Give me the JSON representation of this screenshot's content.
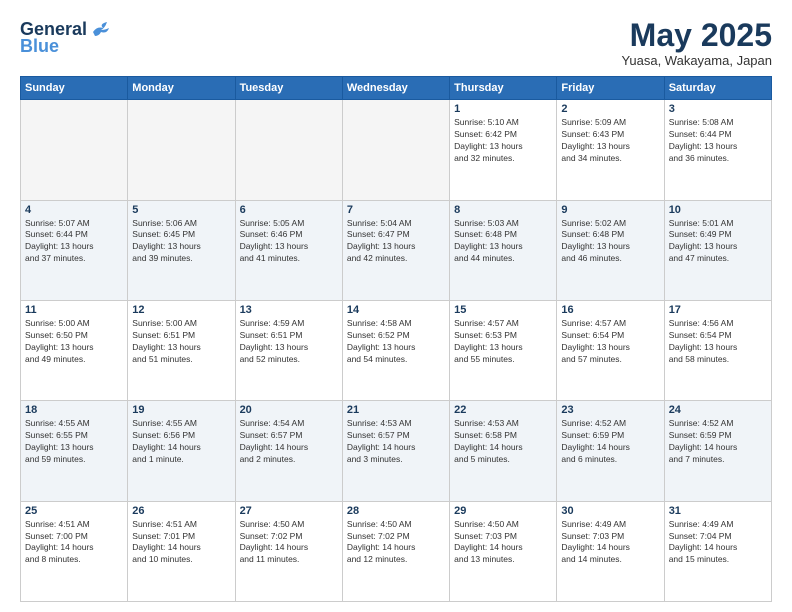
{
  "header": {
    "logo_line1": "General",
    "logo_line2": "Blue",
    "title": "May 2025",
    "location": "Yuasa, Wakayama, Japan"
  },
  "weekdays": [
    "Sunday",
    "Monday",
    "Tuesday",
    "Wednesday",
    "Thursday",
    "Friday",
    "Saturday"
  ],
  "weeks": [
    [
      {
        "day": "",
        "info": ""
      },
      {
        "day": "",
        "info": ""
      },
      {
        "day": "",
        "info": ""
      },
      {
        "day": "",
        "info": ""
      },
      {
        "day": "1",
        "info": "Sunrise: 5:10 AM\nSunset: 6:42 PM\nDaylight: 13 hours\nand 32 minutes."
      },
      {
        "day": "2",
        "info": "Sunrise: 5:09 AM\nSunset: 6:43 PM\nDaylight: 13 hours\nand 34 minutes."
      },
      {
        "day": "3",
        "info": "Sunrise: 5:08 AM\nSunset: 6:44 PM\nDaylight: 13 hours\nand 36 minutes."
      }
    ],
    [
      {
        "day": "4",
        "info": "Sunrise: 5:07 AM\nSunset: 6:44 PM\nDaylight: 13 hours\nand 37 minutes."
      },
      {
        "day": "5",
        "info": "Sunrise: 5:06 AM\nSunset: 6:45 PM\nDaylight: 13 hours\nand 39 minutes."
      },
      {
        "day": "6",
        "info": "Sunrise: 5:05 AM\nSunset: 6:46 PM\nDaylight: 13 hours\nand 41 minutes."
      },
      {
        "day": "7",
        "info": "Sunrise: 5:04 AM\nSunset: 6:47 PM\nDaylight: 13 hours\nand 42 minutes."
      },
      {
        "day": "8",
        "info": "Sunrise: 5:03 AM\nSunset: 6:48 PM\nDaylight: 13 hours\nand 44 minutes."
      },
      {
        "day": "9",
        "info": "Sunrise: 5:02 AM\nSunset: 6:48 PM\nDaylight: 13 hours\nand 46 minutes."
      },
      {
        "day": "10",
        "info": "Sunrise: 5:01 AM\nSunset: 6:49 PM\nDaylight: 13 hours\nand 47 minutes."
      }
    ],
    [
      {
        "day": "11",
        "info": "Sunrise: 5:00 AM\nSunset: 6:50 PM\nDaylight: 13 hours\nand 49 minutes."
      },
      {
        "day": "12",
        "info": "Sunrise: 5:00 AM\nSunset: 6:51 PM\nDaylight: 13 hours\nand 51 minutes."
      },
      {
        "day": "13",
        "info": "Sunrise: 4:59 AM\nSunset: 6:51 PM\nDaylight: 13 hours\nand 52 minutes."
      },
      {
        "day": "14",
        "info": "Sunrise: 4:58 AM\nSunset: 6:52 PM\nDaylight: 13 hours\nand 54 minutes."
      },
      {
        "day": "15",
        "info": "Sunrise: 4:57 AM\nSunset: 6:53 PM\nDaylight: 13 hours\nand 55 minutes."
      },
      {
        "day": "16",
        "info": "Sunrise: 4:57 AM\nSunset: 6:54 PM\nDaylight: 13 hours\nand 57 minutes."
      },
      {
        "day": "17",
        "info": "Sunrise: 4:56 AM\nSunset: 6:54 PM\nDaylight: 13 hours\nand 58 minutes."
      }
    ],
    [
      {
        "day": "18",
        "info": "Sunrise: 4:55 AM\nSunset: 6:55 PM\nDaylight: 13 hours\nand 59 minutes."
      },
      {
        "day": "19",
        "info": "Sunrise: 4:55 AM\nSunset: 6:56 PM\nDaylight: 14 hours\nand 1 minute."
      },
      {
        "day": "20",
        "info": "Sunrise: 4:54 AM\nSunset: 6:57 PM\nDaylight: 14 hours\nand 2 minutes."
      },
      {
        "day": "21",
        "info": "Sunrise: 4:53 AM\nSunset: 6:57 PM\nDaylight: 14 hours\nand 3 minutes."
      },
      {
        "day": "22",
        "info": "Sunrise: 4:53 AM\nSunset: 6:58 PM\nDaylight: 14 hours\nand 5 minutes."
      },
      {
        "day": "23",
        "info": "Sunrise: 4:52 AM\nSunset: 6:59 PM\nDaylight: 14 hours\nand 6 minutes."
      },
      {
        "day": "24",
        "info": "Sunrise: 4:52 AM\nSunset: 6:59 PM\nDaylight: 14 hours\nand 7 minutes."
      }
    ],
    [
      {
        "day": "25",
        "info": "Sunrise: 4:51 AM\nSunset: 7:00 PM\nDaylight: 14 hours\nand 8 minutes."
      },
      {
        "day": "26",
        "info": "Sunrise: 4:51 AM\nSunset: 7:01 PM\nDaylight: 14 hours\nand 10 minutes."
      },
      {
        "day": "27",
        "info": "Sunrise: 4:50 AM\nSunset: 7:02 PM\nDaylight: 14 hours\nand 11 minutes."
      },
      {
        "day": "28",
        "info": "Sunrise: 4:50 AM\nSunset: 7:02 PM\nDaylight: 14 hours\nand 12 minutes."
      },
      {
        "day": "29",
        "info": "Sunrise: 4:50 AM\nSunset: 7:03 PM\nDaylight: 14 hours\nand 13 minutes."
      },
      {
        "day": "30",
        "info": "Sunrise: 4:49 AM\nSunset: 7:03 PM\nDaylight: 14 hours\nand 14 minutes."
      },
      {
        "day": "31",
        "info": "Sunrise: 4:49 AM\nSunset: 7:04 PM\nDaylight: 14 hours\nand 15 minutes."
      }
    ]
  ]
}
